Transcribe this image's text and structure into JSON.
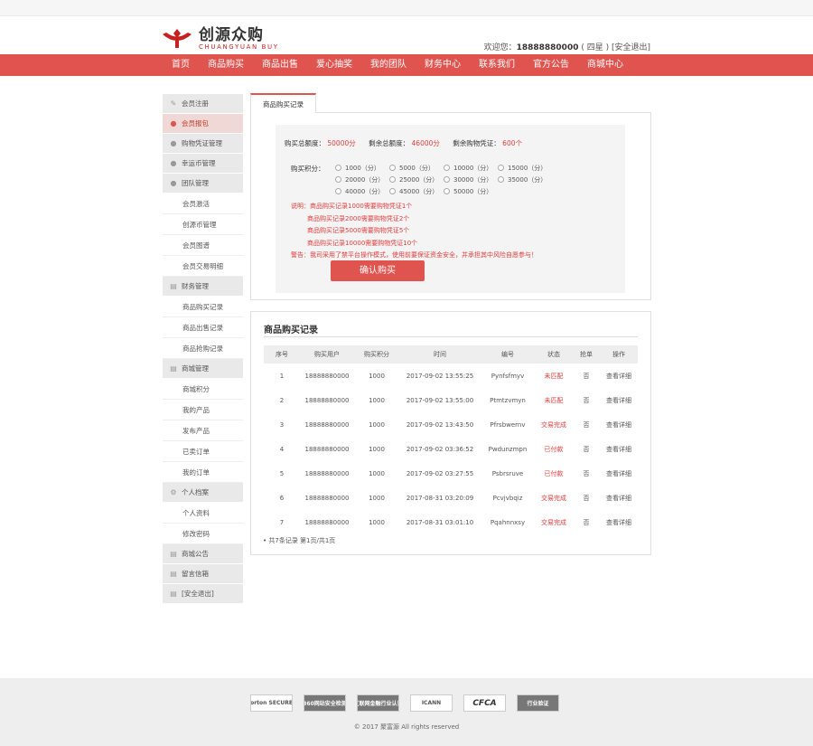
{
  "header": {
    "logo_cn": "创源众购",
    "logo_en": "CHUANGYUAN BUY",
    "welcome_prefix": "欢迎您：",
    "phone": "18888880000",
    "level": "( 四星 )",
    "logout": "[安全退出]"
  },
  "nav": [
    "首页",
    "商品购买",
    "商品出售",
    "爱心抽奖",
    "我的团队",
    "财务中心",
    "联系我们",
    "官方公告",
    "商城中心"
  ],
  "sidebar": [
    {
      "label": "会员注册",
      "type": "cat",
      "icon": "edit-icon"
    },
    {
      "label": "会员报包",
      "type": "cat",
      "icon": "user-icon",
      "active": true
    },
    {
      "label": "购物凭证管理",
      "type": "cat",
      "icon": "user-icon"
    },
    {
      "label": "幸运币管理",
      "type": "cat",
      "icon": "user-icon"
    },
    {
      "label": "团队管理",
      "type": "cat",
      "icon": "user-icon"
    },
    {
      "label": "会员激活",
      "type": "sub"
    },
    {
      "label": "创源币管理",
      "type": "sub"
    },
    {
      "label": "会员图谱",
      "type": "sub"
    },
    {
      "label": "会员交易明细",
      "type": "sub"
    },
    {
      "label": "财务管理",
      "type": "cat",
      "icon": "doc-icon"
    },
    {
      "label": "商品购买记录",
      "type": "sub"
    },
    {
      "label": "商品出售记录",
      "type": "sub"
    },
    {
      "label": "商品抢购记录",
      "type": "sub"
    },
    {
      "label": "商城管理",
      "type": "cat",
      "icon": "doc-icon"
    },
    {
      "label": "商城积分",
      "type": "sub"
    },
    {
      "label": "我的产品",
      "type": "sub"
    },
    {
      "label": "发布产品",
      "type": "sub"
    },
    {
      "label": "已卖订单",
      "type": "sub"
    },
    {
      "label": "我的订单",
      "type": "sub"
    },
    {
      "label": "个人档案",
      "type": "cat",
      "icon": "gear-icon"
    },
    {
      "label": "个人资料",
      "type": "sub"
    },
    {
      "label": "修改密码",
      "type": "sub"
    },
    {
      "label": "商城公告",
      "type": "cat",
      "icon": "doc-icon"
    },
    {
      "label": "留言信箱",
      "type": "cat",
      "icon": "doc-icon"
    },
    {
      "label": "[安全退出]",
      "type": "cat",
      "icon": "doc-icon"
    }
  ],
  "purchase": {
    "tab": "商品购买记录",
    "total_label": "购买总额度：",
    "total_value": "50000分",
    "remain_label": "剩余总额度：",
    "remain_value": "46000分",
    "voucher_label": "剩余购物凭证：",
    "voucher_value": "600个",
    "points_label": "购买积分：",
    "options": [
      "1000（分）",
      "5000（分）",
      "10000（分）",
      "15000（分）",
      "20000（分）",
      "25000（分）",
      "30000（分）",
      "35000（分）",
      "40000（分）",
      "45000（分）",
      "50000（分）"
    ],
    "notes": [
      "说明：商品购买记录1000需要购物凭证1个",
      "商品购买记录2000需要购物凭证2个",
      "商品购买记录5000需要购物凭证5个",
      "商品购买记录10000需要购物凭证10个",
      "警告：我司采用了禁平台操作模式，使用前要保证资金安全，并承担其中风险自愿参与！"
    ],
    "confirm": "确认购买"
  },
  "records": {
    "title": "商品购买记录",
    "headers": [
      "序号",
      "购买用户",
      "购买积分",
      "时间",
      "编号",
      "状态",
      "抢单",
      "操作"
    ],
    "rows": [
      [
        "1",
        "18888880000",
        "1000",
        "2017-09-02 13:55:25",
        "Pynfsfmyv",
        "未匹配",
        "否",
        "查看详细"
      ],
      [
        "2",
        "18888880000",
        "1000",
        "2017-09-02 13:55:00",
        "Ptmtzvmyn",
        "未匹配",
        "否",
        "查看详细"
      ],
      [
        "3",
        "18888880000",
        "1000",
        "2017-09-02 13:43:50",
        "Pfrsbwernv",
        "交易完成",
        "否",
        "查看详细"
      ],
      [
        "4",
        "18888880000",
        "1000",
        "2017-09-02 03:36:52",
        "Pwdunzmpn",
        "已付款",
        "否",
        "查看详细"
      ],
      [
        "5",
        "18888880000",
        "1000",
        "2017-09-02 03:27:55",
        "Psbrsruve",
        "已付款",
        "否",
        "查看详细"
      ],
      [
        "6",
        "18888880000",
        "1000",
        "2017-08-31 03:20:09",
        "Pcvjvbqiz",
        "交易完成",
        "否",
        "查看详细"
      ],
      [
        "7",
        "18888880000",
        "1000",
        "2017-08-31 03:01:10",
        "Pqahnnxsy",
        "交易完成",
        "否",
        "查看详细"
      ]
    ],
    "pager": "共7条记录 第1页/共1页"
  },
  "footer": {
    "badges": [
      "Norton SECURED",
      "360网站安全检测",
      "互联网金融行业认证",
      "ICANN",
      "CFCA",
      "行业验证"
    ],
    "copyright": "© 2017 聚富源 All rights reserved"
  },
  "colors": {
    "brand": "#e05450",
    "alert": "#e03c3c"
  }
}
